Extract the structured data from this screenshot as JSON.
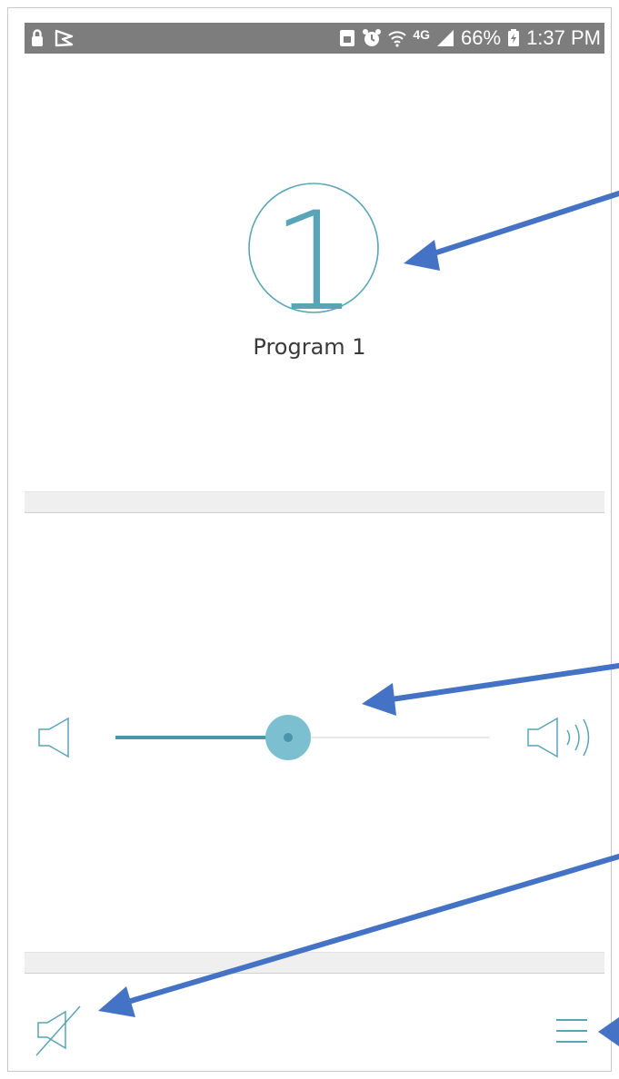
{
  "status_bar": {
    "battery_percent": "66%",
    "time": "1:37 PM",
    "network": "4G",
    "icons": [
      "lock-icon",
      "flag-icon",
      "sd-card-icon",
      "alarm-icon",
      "wifi-icon",
      "signal-icon",
      "battery-icon"
    ]
  },
  "program": {
    "number": "1",
    "label": "Program 1"
  },
  "volume": {
    "level": 0.46,
    "icons": [
      "volume-low-icon",
      "volume-high-icon"
    ]
  },
  "bottom_bar": {
    "icons": [
      "mute-icon",
      "menu-icon"
    ]
  },
  "colors": {
    "accent": "#5aa4b8",
    "accent_dark": "#4a95aa",
    "thumb": "#7cbfd0",
    "status_bar": "#7d7d7d",
    "annotation_arrow": "#4472c4"
  }
}
